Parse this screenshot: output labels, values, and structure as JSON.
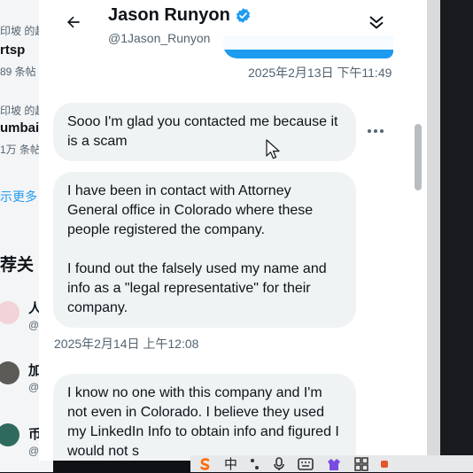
{
  "background_left": {
    "trend1_meta": "印坡 的超",
    "trend1_title": "rtsp",
    "trend1_count": "89 条帖",
    "trend2_meta": "印坡 的超",
    "trend2_title": "umbai",
    "trend2_count": "1万 条帖",
    "show_more": "示更多",
    "who_to_follow_heading": "荐关",
    "suggest1_name": "人",
    "suggest1_handle": "@",
    "suggest2_name": "加",
    "suggest2_handle": "@",
    "suggest3_name": "币",
    "suggest3_handle": "@"
  },
  "header": {
    "name": "Jason Runyon",
    "handle": "@1Jason_Runyon"
  },
  "timestamps": {
    "sent": "2025年2月13日 下午11:49",
    "received": "2025年2月14日 上午12:08"
  },
  "messages": [
    {
      "text": "Sooo I'm glad you contacted me because it is a scam"
    },
    {
      "text": "I have been in contact with Attorney General office in Colorado where these people registered the company.\n\nI found out the falsely used my name and info as a \"legal representative\" for their company."
    },
    {
      "text": "I know no one with this company and I'm not even in Colorado.  I believe they used my LinkedIn Info to obtain info and figured I would not s"
    }
  ],
  "taskbar": {
    "ime_label": "中"
  },
  "colors": {
    "accent": "#1d9bf0",
    "bubble_received": "#eff3f4",
    "text_primary": "#0f1419",
    "text_secondary": "#536471"
  }
}
